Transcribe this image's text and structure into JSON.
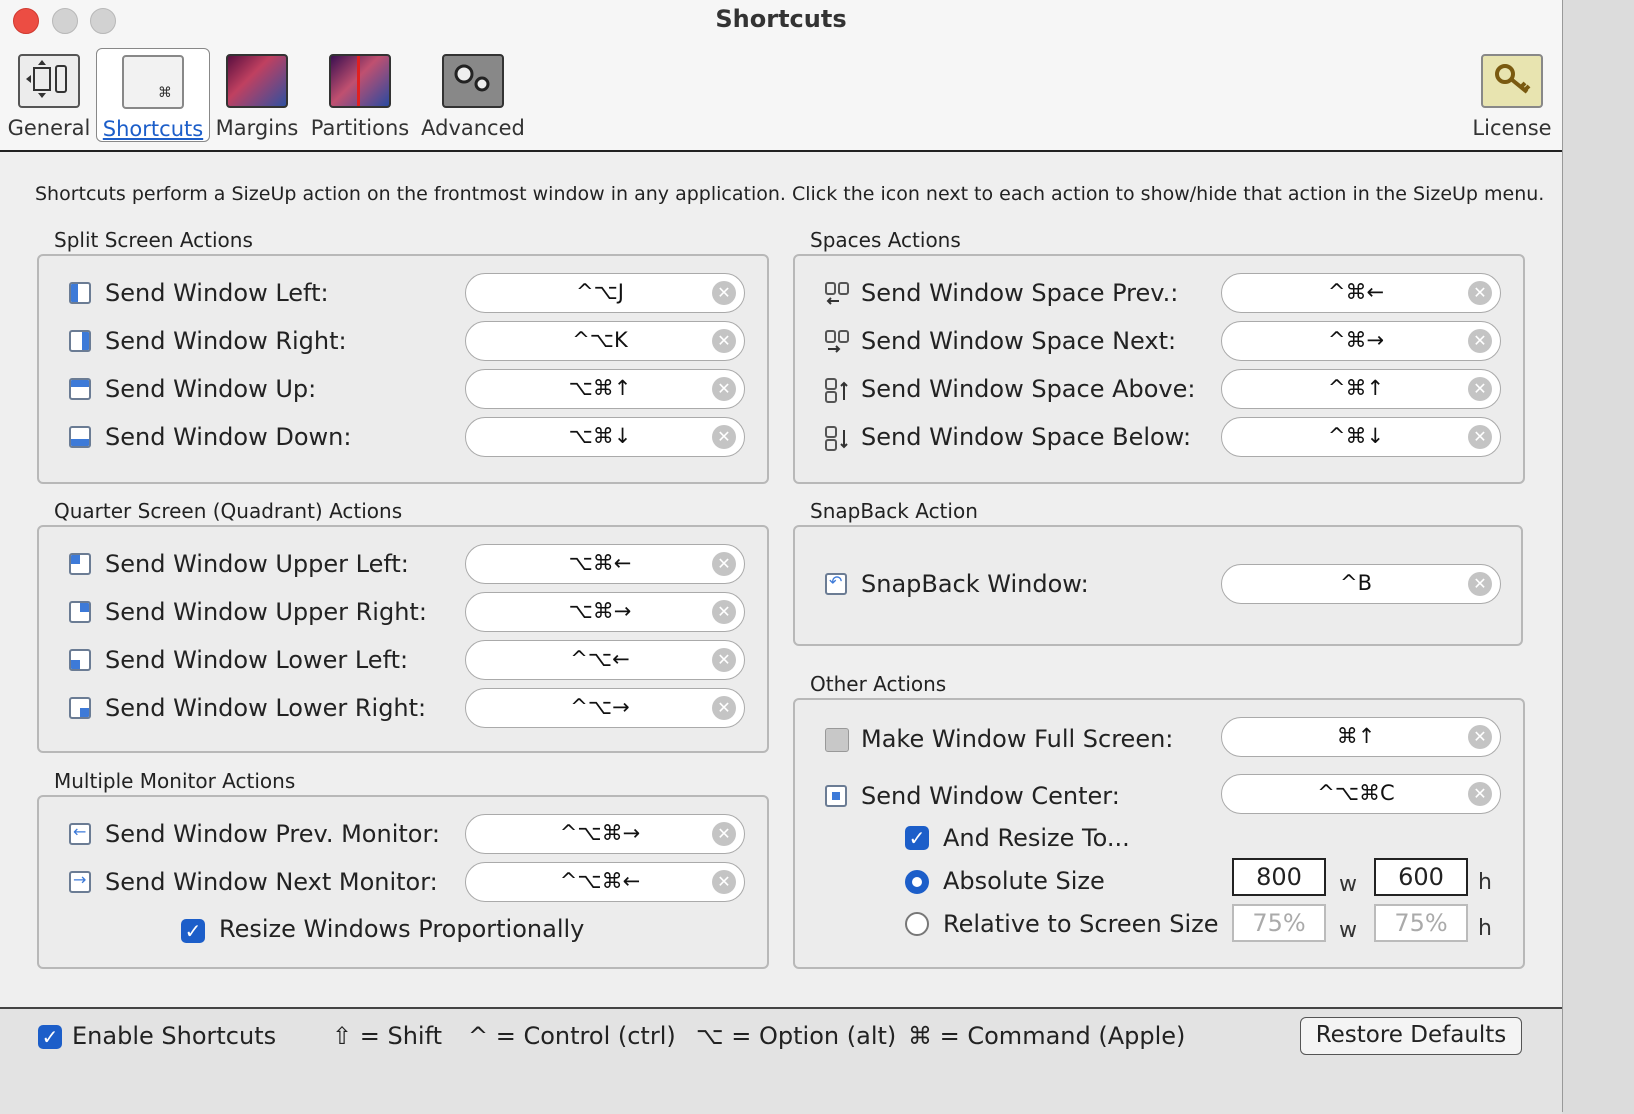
{
  "window": {
    "title": "Shortcuts"
  },
  "toolbar": {
    "items": [
      {
        "label": "General",
        "icon": "general-icon"
      },
      {
        "label": "Shortcuts",
        "icon": "shortcuts-icon",
        "active": true
      },
      {
        "label": "Margins",
        "icon": "margins-icon"
      },
      {
        "label": "Partitions",
        "icon": "partitions-icon"
      },
      {
        "label": "Advanced",
        "icon": "advanced-icon"
      }
    ],
    "license": "License",
    "shortcut_icon_glyph": "⌘"
  },
  "description": "Shortcuts perform a SizeUp action on the frontmost window in any application. Click the icon next to each action to show/hide that action in the SizeUp menu.",
  "split": {
    "title": "Split Screen Actions",
    "rows": [
      {
        "label": "Send Window Left:",
        "key": "^⌥J"
      },
      {
        "label": "Send Window Right:",
        "key": "^⌥K"
      },
      {
        "label": "Send Window Up:",
        "key": "⌥⌘↑"
      },
      {
        "label": "Send Window Down:",
        "key": "⌥⌘↓"
      }
    ]
  },
  "quarter": {
    "title": "Quarter Screen (Quadrant) Actions",
    "rows": [
      {
        "label": "Send Window Upper Left:",
        "key": "⌥⌘←"
      },
      {
        "label": "Send Window Upper Right:",
        "key": "⌥⌘→"
      },
      {
        "label": "Send Window Lower Left:",
        "key": "^⌥←"
      },
      {
        "label": "Send Window Lower Right:",
        "key": "^⌥→"
      }
    ]
  },
  "monitor": {
    "title": "Multiple Monitor Actions",
    "rows": [
      {
        "label": "Send Window Prev. Monitor:",
        "key": "^⌥⌘→"
      },
      {
        "label": "Send Window Next Monitor:",
        "key": "^⌥⌘←"
      }
    ],
    "resize_label": "Resize Windows Proportionally"
  },
  "spaces": {
    "title": "Spaces Actions",
    "rows": [
      {
        "label": "Send Window Space Prev.:",
        "key": "^⌘←"
      },
      {
        "label": "Send Window Space Next:",
        "key": "^⌘→"
      },
      {
        "label": "Send Window Space Above:",
        "key": "^⌘↑"
      },
      {
        "label": "Send Window Space Below:",
        "key": "^⌘↓"
      }
    ]
  },
  "snapback": {
    "title": "SnapBack Action",
    "label": "SnapBack Window:",
    "key": "^B"
  },
  "other": {
    "title": "Other Actions",
    "full_label": "Make Window Full Screen:",
    "full_key": "⌘↑",
    "center_label": "Send Window Center:",
    "center_key": "^⌥⌘C",
    "resize_to_label": "And Resize To...",
    "absolute_label": "Absolute Size",
    "relative_label": "Relative to Screen Size",
    "abs_w": "800",
    "abs_h": "600",
    "rel_w": "75%",
    "rel_h": "75%",
    "w_unit": "w",
    "h_unit": "h"
  },
  "footer": {
    "enable_label": "Enable Shortcuts",
    "shift": "⇧ = Shift",
    "control": "^ = Control (ctrl)",
    "option": "⌥ = Option (alt)",
    "command": "⌘ = Command (Apple)",
    "restore": "Restore Defaults"
  },
  "glyphs": {
    "check": "✓",
    "clear": "✕"
  },
  "colors": {
    "accent": "#1c5ec9",
    "window_icon_fill": "#3d7ad8",
    "close": "#ec4d43"
  }
}
